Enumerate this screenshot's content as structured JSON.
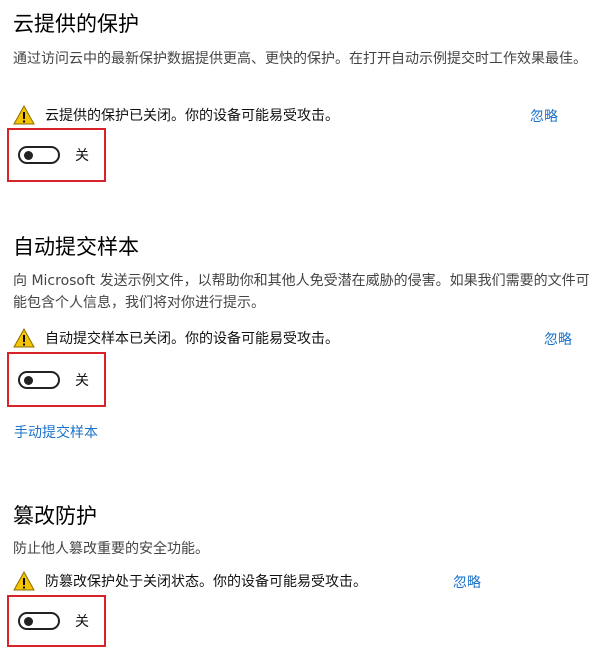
{
  "sections": [
    {
      "title": "云提供的保护",
      "description": "通过访问云中的最新保护数据提供更高、更快的保护。在打开自动示例提交时工作效果最佳。",
      "warning": "云提供的保护已关闭。你的设备可能易受攻击。",
      "dismiss": "忽略",
      "toggle_label": "关",
      "toggle_on": false
    },
    {
      "title": "自动提交样本",
      "description": "向 Microsoft 发送示例文件，以帮助你和其他人免受潜在威胁的侵害。如果我们需要的文件可能包含个人信息，我们将对你进行提示。",
      "warning": "自动提交样本已关闭。你的设备可能易受攻击。",
      "dismiss": "忽略",
      "toggle_label": "关",
      "toggle_on": false,
      "link": "手动提交样本"
    },
    {
      "title": "篡改防护",
      "description": "防止他人篡改重要的安全功能。",
      "warning": "防篡改保护处于关闭状态。你的设备可能易受攻击。",
      "dismiss": "忽略",
      "toggle_label": "关",
      "toggle_on": false
    }
  ],
  "colors": {
    "link": "#1a73c9",
    "highlight_border": "#d9222a",
    "warning_fill": "#f5c400"
  },
  "icons": {
    "warning": "warning-icon"
  }
}
